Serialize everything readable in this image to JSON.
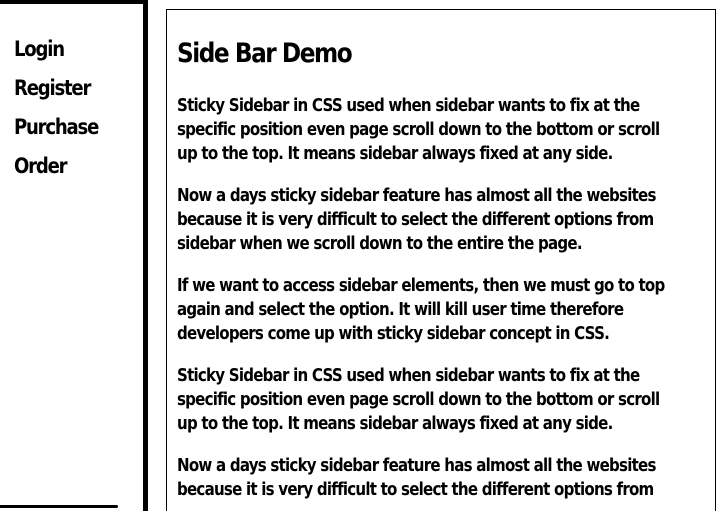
{
  "sidebar": {
    "items": [
      {
        "label": "Login"
      },
      {
        "label": "Register"
      },
      {
        "label": "Purchase"
      },
      {
        "label": "Order"
      }
    ]
  },
  "main": {
    "title": "Side Bar Demo",
    "paragraphs": [
      {
        "lines": [
          "Sticky Sidebar in CSS used when sidebar wants to fix at the",
          "specific position even page scroll down to the bottom or scroll",
          "up to the top. It means sidebar always fixed at any side."
        ]
      },
      {
        "lines": [
          "Now a days sticky sidebar feature has almost all the websites",
          "because it is very difficult to select the different options from",
          "sidebar when we scroll down to the entire the page."
        ]
      },
      {
        "lines": [
          "If we want to access sidebar elements, then we must go to top",
          "again and select the option. It will kill user time therefore",
          "developers come up with sticky sidebar concept in CSS."
        ]
      },
      {
        "lines": [
          "Sticky Sidebar in CSS used when sidebar wants to fix at the",
          "specific position even page scroll down to the bottom or scroll",
          "up to the top. It means sidebar always fixed at any side."
        ]
      },
      {
        "lines": [
          "Now a days sticky sidebar feature has almost all the websites",
          "because it is very difficult to select the different options from"
        ]
      }
    ]
  },
  "colors": {
    "background": "#ffffff",
    "text": "#000000",
    "border": "#000000"
  }
}
